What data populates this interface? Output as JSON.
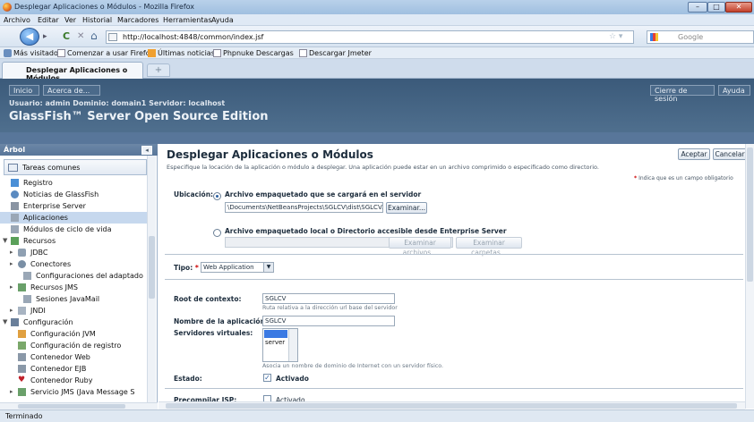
{
  "window": {
    "title": "Desplegar Aplicaciones o Módulos - Mozilla Firefox",
    "min": "–",
    "max": "□",
    "close": "✕"
  },
  "menu": [
    "Archivo",
    "Editar",
    "Ver",
    "Historial",
    "Marcadores",
    "Herramientas",
    "Ayuda"
  ],
  "nav": {
    "url": "http://localhost:4848/common/index.jsf",
    "search_placeholder": "Google",
    "back": "◀",
    "forward": "▸",
    "reload": "C",
    "stop": "✕",
    "home": "⌂"
  },
  "bookmarks": [
    "Más visitados",
    "Comenzar a usar Firefox",
    "Últimas noticias",
    "Phpnuke Descargas",
    "Descargar Jmeter"
  ],
  "tab": {
    "label": "Desplegar Aplicaciones o Módulos",
    "new_tab": "+"
  },
  "header": {
    "links": [
      "Inicio",
      "Acerca de..."
    ],
    "right_links": [
      "Cierre de sesión",
      "Ayuda"
    ],
    "info": "Usuario: admin   Dominio: domain1   Servidor: localhost",
    "title": "GlassFish™ Server Open Source Edition"
  },
  "sidebar": {
    "title": "Árbol",
    "tareas": "Tareas comunes",
    "items": [
      "Registro",
      "Noticias de GlassFish",
      "Enterprise Server",
      "Aplicaciones",
      "Módulos de ciclo de vida",
      "Recursos",
      "JDBC",
      "Conectores",
      "Configuraciones del adaptado",
      "Recursos JMS",
      "Sesiones JavaMail",
      "JNDI",
      "Configuración",
      "Configuración JVM",
      "Configuración de registro",
      "Contenedor Web",
      "Contenedor EJB",
      "Contenedor Ruby",
      "Servicio JMS (Java Message S"
    ]
  },
  "main": {
    "title": "Desplegar Aplicaciones o Módulos",
    "description": "Especifique la locación de la aplicación o módulo a desplegar. Una aplicación puede estar en un archivo comprimido o especificado como directorio.",
    "accept": "Aceptar",
    "cancel": "Cancelar",
    "required_note": "Indica que es un campo obligatorio",
    "location_label": "Ubicación:",
    "option1": "Archivo empaquetado que se cargará en el servidor",
    "file_path": "\\Documents\\NetBeansProjects\\SGLCV\\dist\\SGLCV.war",
    "browse": "Examinar...",
    "option2": "Archivo empaquetado local o Directorio accesible desde Enterprise Server",
    "browse_files": "Examinar archivos...",
    "browse_folders": "Examinar carpetas...",
    "type_label": "Tipo:",
    "type_value": "Web Application",
    "context_root_label": "Root de contexto:",
    "context_root_value": "SGLCV",
    "context_root_hint": "Ruta relativa a la dirección url base del servidor",
    "app_name_label": "Nombre de la aplicación:",
    "app_name_value": "SGLCV",
    "virtual_servers_label": "Servidores virtuales:",
    "virtual_server_option": "server",
    "virtual_servers_hint": "Asocia un nombre de dominio de Internet con un servidor físico.",
    "status_label": "Estado:",
    "status_value": "Activado",
    "precompile_label": "Precompilar JSP:",
    "precompile_value": "Activado"
  },
  "status": "Terminado"
}
